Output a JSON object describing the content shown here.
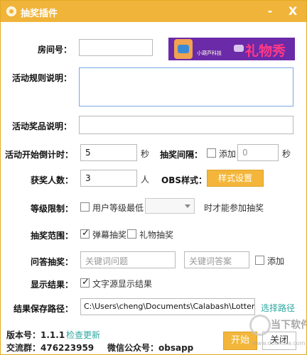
{
  "window": {
    "title": "抽奖插件",
    "minimize": "-",
    "close": "X"
  },
  "room": {
    "label": "房间号：",
    "value": ""
  },
  "logo": {
    "text": "礼物秀",
    "caption": "小葫芦科技"
  },
  "rules": {
    "label": "活动规则说明：",
    "value": ""
  },
  "prize": {
    "label": "活动奖品说明：",
    "value": ""
  },
  "countdown": {
    "label": "活动开始倒计时：",
    "value": "5",
    "unit": "秒"
  },
  "interval": {
    "label": "抽奖间隔：",
    "checkbox_label": "添加",
    "checked": false,
    "value": "0",
    "unit": "秒"
  },
  "winners": {
    "label": "获奖人数：",
    "value": "3",
    "unit": "人"
  },
  "obs": {
    "label": "OBS样式：",
    "button": "样式设置"
  },
  "level": {
    "label": "等级限制：",
    "checkbox_label": "用户等级最低",
    "checked": false,
    "select_value": "",
    "suffix": "时才能参加抽奖"
  },
  "scope": {
    "label": "抽奖范围：",
    "options": [
      {
        "label": "弹幕抽奖",
        "checked": true
      },
      {
        "label": "礼物抽奖",
        "checked": false
      }
    ]
  },
  "qa": {
    "label": "问答抽奖：",
    "question_placeholder": "关键词问题",
    "answer_placeholder": "关键词答案",
    "add_label": "添加",
    "add_checked": false
  },
  "display": {
    "label": "显示结果：",
    "checkbox_label": "文字源显示结果",
    "checked": true
  },
  "save": {
    "label": "结果保存路径：",
    "path": "C:\\Users\\cheng\\Documents\\Calabash\\Lottery",
    "link": "选择路径"
  },
  "footer": {
    "version_label": "版本号：1.1.1",
    "update_link": "检查更新",
    "group_label": "交流群：476223959",
    "wechat_label": "微信公众号：obsapp",
    "start_button": "开始",
    "close_button": "关闭"
  },
  "watermark": {
    "text": "当下软件园",
    "url": "www.downxia.com"
  },
  "colors": {
    "accent": "#f0b43a",
    "link": "#2ea7a0",
    "logo_bg": "#6b2aa8"
  }
}
